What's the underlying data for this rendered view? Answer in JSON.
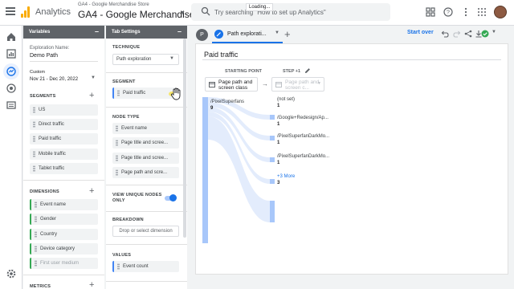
{
  "topbar": {
    "app_name": "Analytics",
    "account_path": "GA4 - Google Merchandise Store",
    "property_name": "GA4 - Google Merchandise ...",
    "search_placeholder": "Try searching \"How to set up Analytics\"",
    "loading_text": "Loading..."
  },
  "variables": {
    "header": "Variables",
    "exploration_name_label": "Exploration Name:",
    "exploration_name": "Demo Path",
    "date_label": "Custom",
    "date_range": "Nov 21 - Dec 20, 2022",
    "segments_heading": "SEGMENTS",
    "segments": [
      "US",
      "Direct traffic",
      "Paid traffic",
      "Mobile traffic",
      "Tablet traffic"
    ],
    "dimensions_heading": "DIMENSIONS",
    "dimensions": [
      "Event name",
      "Gender",
      "Country",
      "Device category",
      "First user medium"
    ],
    "metrics_heading": "METRICS"
  },
  "tab_settings": {
    "header": "Tab Settings",
    "technique_heading": "TECHNIQUE",
    "technique_value": "Path exploration",
    "segment_heading": "SEGMENT",
    "segment_value": "Paid traffic",
    "node_type_heading": "NODE TYPE",
    "node_types": [
      "Event name",
      "Page title and scree...",
      "Page title and scree...",
      "Page path and scre..."
    ],
    "view_unique_label": "VIEW UNIQUE NODES ONLY",
    "view_unique_on": true,
    "breakdown_heading": "BREAKDOWN",
    "breakdown_placeholder": "Drop or select dimension",
    "values_heading": "VALUES",
    "values_value": "Event count"
  },
  "canvas": {
    "tab_badge": "P",
    "tab_label": "Path explorati...",
    "start_over": "Start over",
    "card_title": "Paid traffic",
    "starting_point_label": "STARTING POINT",
    "step1_label": "STEP +1",
    "starting_dimension": "Page path and screen class",
    "step1_dimension": "Page path and screen c...",
    "start_node": {
      "name": "/PixelSuperfans",
      "value": "9"
    },
    "step_nodes": [
      {
        "name": "(not set)",
        "value": "1"
      },
      {
        "name": "/Google+Redesign/Ap...",
        "value": "1"
      },
      {
        "name": "/PixelSuperfanDarkMo...",
        "value": "1"
      },
      {
        "name": "/PixelSuperfanDarkMo...",
        "value": "1"
      }
    ],
    "more_label": "+3 More",
    "more_value": "3"
  },
  "colors": {
    "accent": "#1a73e8",
    "node_bar": "#a8c7fa",
    "flow": "#e3ecfc",
    "chip_green": "#34a853",
    "chip_blue": "#4285f4",
    "panel_header": "#5f6368"
  }
}
